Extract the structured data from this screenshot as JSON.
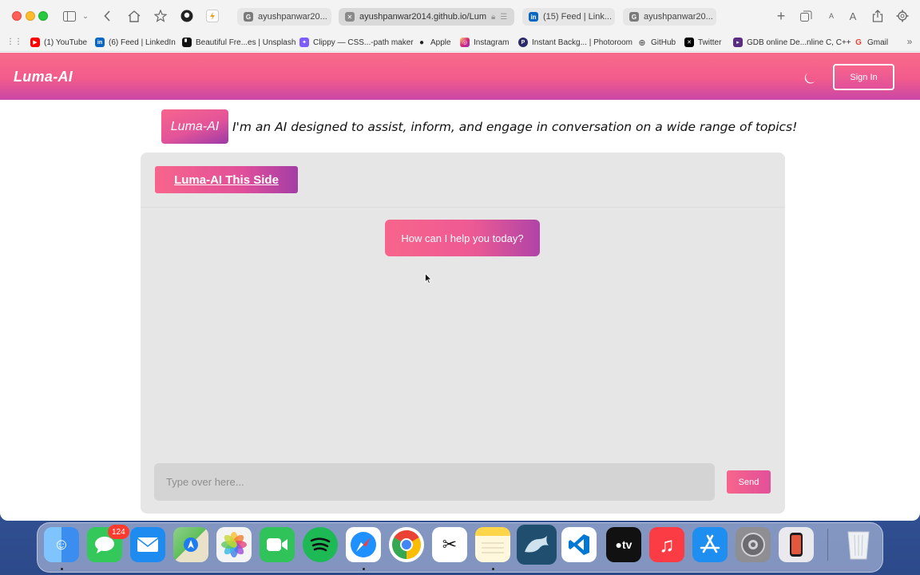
{
  "browser": {
    "tabs": [
      {
        "label": "ayushpanwar20...",
        "favicon": "google-icon",
        "active": false
      },
      {
        "label": "ayushpanwar2014.github.io/Lum",
        "favicon": "close-tab-icon",
        "active": true
      },
      {
        "label": "(15) Feed | Link...",
        "favicon": "linkedin-icon",
        "active": false
      },
      {
        "label": "ayushpanwar20...",
        "favicon": "google-icon",
        "active": false
      }
    ],
    "zoom_small": "A",
    "zoom_large": "A",
    "favorites": [
      {
        "label": "(1) YouTube",
        "icon": "youtube-icon",
        "color": "#ff0000"
      },
      {
        "label": "(6) Feed | LinkedIn",
        "icon": "linkedin-icon",
        "color": "#0a66c2"
      },
      {
        "label": "Beautiful Fre...es | Unsplash",
        "icon": "unsplash-icon",
        "color": "#111111"
      },
      {
        "label": "Clippy — CSS...-path maker",
        "icon": "clippy-icon",
        "color": "#7c5cff"
      },
      {
        "label": "Apple",
        "icon": "apple-icon",
        "color": "#222222"
      },
      {
        "label": "Instagram",
        "icon": "instagram-icon",
        "color": "#d6249f"
      },
      {
        "label": "Instant Backg... | Photoroom",
        "icon": "photoroom-icon",
        "color": "#2b2b6b"
      },
      {
        "label": "GitHub",
        "icon": "globe-icon",
        "color": "#666666"
      },
      {
        "label": "Twitter",
        "icon": "x-icon",
        "color": "#000000"
      },
      {
        "label": "GDB online De...nline C, C++",
        "icon": "gdb-icon",
        "color": "#5a2d82"
      },
      {
        "label": "Gmail",
        "icon": "google-icon",
        "color": "#ea4335"
      }
    ]
  },
  "page": {
    "brand": "Luma-AI",
    "signin_label": "Sign In",
    "intro_badge": "Luma-AI",
    "intro_text": "I'm an AI designed to assist, inform, and engage in conversation on a wide range of topics!",
    "chat_header": "Luma-AI This Side",
    "bot_message": "How can I help you today?",
    "input_placeholder": "Type over here...",
    "send_label": "Send",
    "accent_pink": "#f7658c",
    "accent_purple": "#a43da6"
  },
  "dock": {
    "messages_badge": "124",
    "apps": [
      {
        "name": "finder-icon",
        "color": "#3b8ef0"
      },
      {
        "name": "messages-icon",
        "color": "#34c759"
      },
      {
        "name": "mail-icon",
        "color": "#1e8bf0"
      },
      {
        "name": "maps-icon",
        "color": "#5fbf5a"
      },
      {
        "name": "photos-icon",
        "color": "#f4f4f4"
      },
      {
        "name": "facetime-icon",
        "color": "#2fc35a"
      },
      {
        "name": "spotify-icon",
        "color": "#1db954"
      },
      {
        "name": "safari-icon",
        "color": "#1e90ff"
      },
      {
        "name": "chrome-icon",
        "color": "#ffffff"
      },
      {
        "name": "capcut-icon",
        "color": "#ffffff"
      },
      {
        "name": "notes-icon",
        "color": "#fff6c8"
      },
      {
        "name": "mysql-workbench-icon",
        "color": "#1f4e6e"
      },
      {
        "name": "vscode-icon",
        "color": "#ffffff"
      },
      {
        "name": "apple-tv-icon",
        "color": "#111111"
      },
      {
        "name": "music-icon",
        "color": "#fc3c44"
      },
      {
        "name": "app-store-icon",
        "color": "#1f8ef1"
      },
      {
        "name": "system-settings-icon",
        "color": "#8e8e93"
      },
      {
        "name": "iphone-mirroring-icon",
        "color": "#e9e9ee"
      },
      {
        "name": "trash-icon",
        "color": "#dfe3e8"
      }
    ]
  }
}
